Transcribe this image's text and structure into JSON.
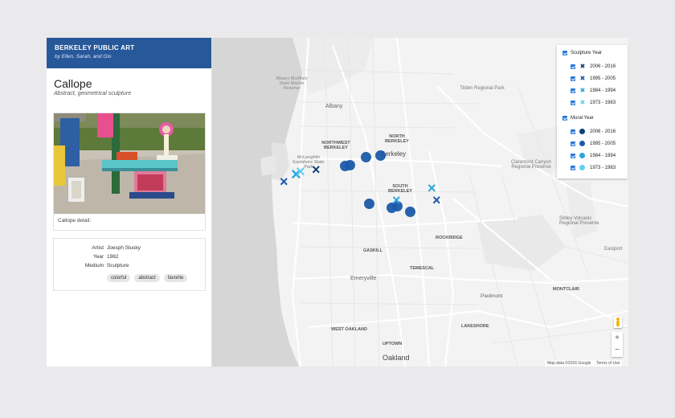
{
  "brand": {
    "title": "BERKELEY PUBLIC ART",
    "subtitle": "by Ellen, Sarah, and Gio"
  },
  "artwork": {
    "title": "Callope",
    "subtitle": "Abstract, geometrical sculpture",
    "caption": "Callope detail:",
    "meta": [
      {
        "label": "Artist",
        "value": "Joesph Slusky"
      },
      {
        "label": "Year",
        "value": "1982"
      },
      {
        "label": "Medium",
        "value": "Sculpture"
      }
    ],
    "tags": [
      "colorful",
      "abstract",
      "favorite"
    ]
  },
  "legend": {
    "sculpture_heading": "Sculpture Year",
    "sculpture_items": [
      {
        "label": "2006 - 2016",
        "color": "#0f3f78",
        "icon": "x-marker-icon"
      },
      {
        "label": "1995 - 2005",
        "color": "#1b5aa8",
        "icon": "x-marker-icon"
      },
      {
        "label": "1984 - 1994",
        "color": "#2ba5e0",
        "icon": "x-marker-icon"
      },
      {
        "label": "1973 - 1983",
        "color": "#5fd0f2",
        "icon": "x-marker-icon"
      }
    ],
    "mural_heading": "Mural Year",
    "mural_items": [
      {
        "label": "2006 - 2016",
        "color": "#0f3f78",
        "icon": "dot-marker-icon"
      },
      {
        "label": "1995 - 2005",
        "color": "#1b5aa8",
        "icon": "dot-marker-icon"
      },
      {
        "label": "1984 - 1994",
        "color": "#2ba5e0",
        "icon": "dot-marker-icon"
      },
      {
        "label": "1973 - 1983",
        "color": "#5fd0f2",
        "icon": "dot-marker-icon"
      }
    ]
  },
  "map": {
    "labels": {
      "berkeley": "Berkeley",
      "oakland": "Oakland",
      "albany": "Albany",
      "albany_mudflats": "Albany Mudflats State Marine Reserve",
      "north_berkeley": "NORTH BERKELEY",
      "northwest_berkeley": "NORTHWEST BERKELEY",
      "south_berkeley": "SOUTH BERKELEY",
      "rockridge": "ROCKRIDGE",
      "gaskill": "GASKILL",
      "temescal": "TEMESCAL",
      "emeryville": "Emeryville",
      "piedmont": "Piedmont",
      "montclair": "MONTCLAIR",
      "lakeshore": "LAKESHORE",
      "west_oakland": "WEST OAKLAND",
      "uptown": "UPTOWN",
      "eastport": "Eastport",
      "tilden": "Tilden Regional Park",
      "claremont": "Claremont Canyon Regional Preserve",
      "sibley": "Sibley Volcanic Regional Preserve",
      "mcclaughlin": "McLaughlin Eastshore State Park"
    },
    "zoom_in": "+",
    "zoom_out": "−",
    "attribution_data": "Map data ©2016 Google",
    "attribution_terms": "Terms of Use"
  }
}
